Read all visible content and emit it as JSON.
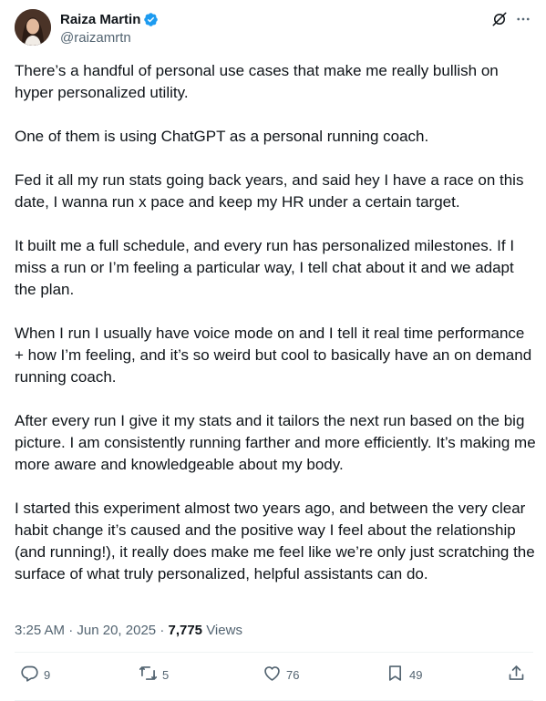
{
  "author": {
    "display_name": "Raiza Martin",
    "handle": "@raizamrtn",
    "verified": true
  },
  "tweet": {
    "paragraphs": [
      "There’s a handful of personal use cases that make me really bullish on hyper personalized utility.",
      "One of them is using ChatGPT as a personal running coach.",
      "Fed it all my run stats going back years, and said hey I have a race on this date, I wanna run x pace and keep my HR under a certain target.",
      "It built me a full schedule, and every run has personalized milestones. If I miss a run or I’m feeling a particular way, I tell chat about it and we adapt the plan.",
      "When I run I usually have voice mode on and I tell it real time performance + how I’m feeling, and it’s so weird but cool to basically have an on demand running coach.",
      "After every run I give it my stats and it tailors the next run based on the big picture. I am consistently running farther and more efficiently. It’s making me more aware and knowledgeable about my body.",
      "I started this experiment almost two years ago, and between the very clear habit change it’s caused and the positive way I feel about the relationship (and running!), it really does make me feel like we’re only just scratching the surface of what truly personalized, helpful assistants can do."
    ],
    "time": "3:25 AM",
    "date": "Jun 20, 2025",
    "views_count": "7,775",
    "views_label": "Views"
  },
  "actions": {
    "replies": "9",
    "reposts": "5",
    "likes": "76",
    "bookmarks": "49"
  },
  "icons": {
    "grok": "grok-icon",
    "more": "more-icon",
    "reply": "reply-icon",
    "repost": "repost-icon",
    "like": "heart-icon",
    "bookmark": "bookmark-icon",
    "share": "share-icon",
    "verified": "verified-badge-icon"
  },
  "colors": {
    "text": "#0f1419",
    "secondary": "#536471",
    "verified": "#1d9bf0",
    "divider": "#eff3f4"
  }
}
